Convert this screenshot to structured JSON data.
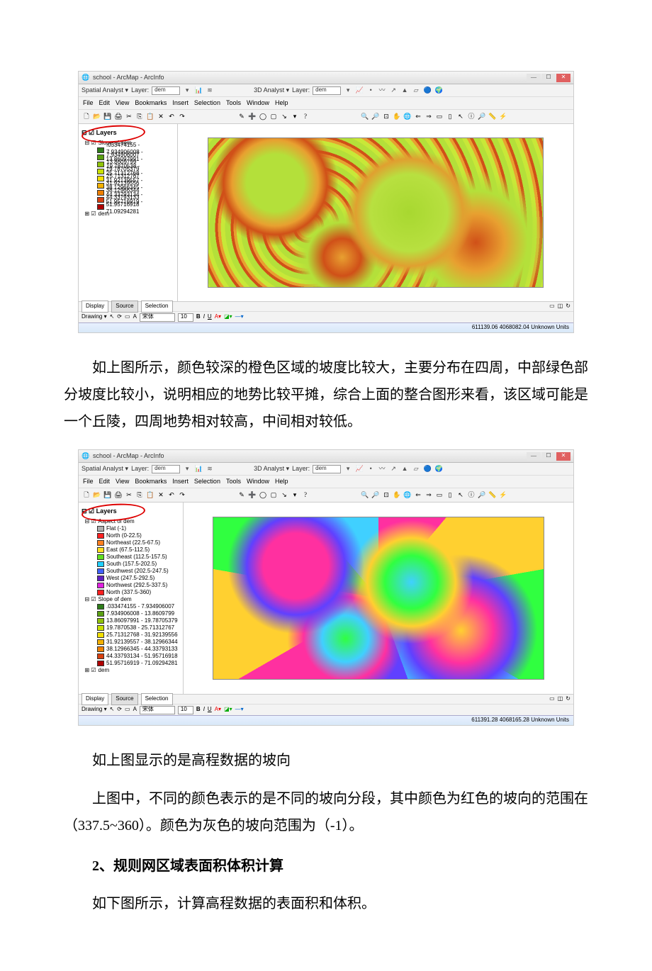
{
  "screenshot1": {
    "window_title": "school - ArcMap - ArcInfo",
    "spatial_toolbar": {
      "label": "Spatial Analyst ▾",
      "layer_label": "Layer:",
      "layer_value": "dem"
    },
    "analyst3d_toolbar": {
      "label": "3D Analyst ▾",
      "layer_label": "Layer:",
      "layer_value": "dem"
    },
    "menu": [
      "File",
      "Edit",
      "View",
      "Bookmarks",
      "Insert",
      "Selection",
      "Tools",
      "Window",
      "Help"
    ],
    "toc": {
      "root": "Layers",
      "group": "Slope of dem",
      "items": [
        {
          "color": "#2e7d1a",
          "label": ".033474155 - 7.934906007"
        },
        {
          "color": "#5aa012",
          "label": "7.934906008 - 13.8609799"
        },
        {
          "color": "#8fc20a",
          "label": "13.86097991 - 19.78705379"
        },
        {
          "color": "#c9e000",
          "label": "19.7870538 - 25.71312767"
        },
        {
          "color": "#f3e000",
          "label": "25.71312768 - 31.92139556"
        },
        {
          "color": "#f3b000",
          "label": "31.92139557 - 38.12966344"
        },
        {
          "color": "#f08000",
          "label": "38.12966345 - 44.33793133"
        },
        {
          "color": "#d84010",
          "label": "44.33793134 - 51.95716918"
        },
        {
          "color": "#b00000",
          "label": "51.95716919 - 71.09294281"
        }
      ],
      "dem_label": "dem"
    },
    "bottom_tabs": [
      "Display",
      "Source",
      "Selection"
    ],
    "drawing": {
      "label": "Drawing ▾",
      "font": "宋体",
      "size": "10"
    },
    "status": "611139.06 4068082.04 Unknown Units"
  },
  "paragraph1": "如上图所示，颜色较深的橙色区域的坡度比较大，主要分布在四周，中部绿色部分坡度比较小，说明相应的地势比较平摊，综合上面的整合图形来看，该区域可能是一个丘陵，四周地势相对较高，中间相对较低。",
  "screenshot2": {
    "window_title": "school - ArcMap - ArcInfo",
    "spatial_toolbar": {
      "label": "Spatial Analyst ▾",
      "layer_label": "Layer:",
      "layer_value": "dem"
    },
    "analyst3d_toolbar": {
      "label": "3D Analyst ▾",
      "layer_label": "Layer:",
      "layer_value": "dem"
    },
    "menu": [
      "File",
      "Edit",
      "View",
      "Bookmarks",
      "Insert",
      "Selection",
      "Tools",
      "Window",
      "Help"
    ],
    "toc": {
      "root": "Layers",
      "group": "Aspect of dem",
      "items": [
        {
          "color": "#b0b0b0",
          "label": "Flat (-1)"
        },
        {
          "color": "#ff2020",
          "label": "North (0-22.5)"
        },
        {
          "color": "#ff8020",
          "label": "Northeast (22.5-67.5)"
        },
        {
          "color": "#ffe020",
          "label": "East (67.5-112.5)"
        },
        {
          "color": "#60e020",
          "label": "Southeast (112.5-157.5)"
        },
        {
          "color": "#20d0ff",
          "label": "South (157.5-202.5)"
        },
        {
          "color": "#4060ff",
          "label": "Southwest (202.5-247.5)"
        },
        {
          "color": "#6020c0",
          "label": "West (247.5-292.5)"
        },
        {
          "color": "#e020e0",
          "label": "Northwest (292.5-337.5)"
        },
        {
          "color": "#ff2020",
          "label": "North (337.5-360)"
        }
      ],
      "group2": "Slope of dem",
      "items2": [
        {
          "color": "#2e7d1a",
          "label": ".033474155 - 7.934906007"
        },
        {
          "color": "#5aa012",
          "label": "7.934906008 - 13.8609799"
        },
        {
          "color": "#8fc20a",
          "label": "13.86097991 - 19.78705379"
        },
        {
          "color": "#c9e000",
          "label": "19.7870538 - 25.71312767"
        },
        {
          "color": "#f3e000",
          "label": "25.71312768 - 31.92139556"
        },
        {
          "color": "#f3b000",
          "label": "31.92139557 - 38.12966344"
        },
        {
          "color": "#f08000",
          "label": "38.12966345 - 44.33793133"
        },
        {
          "color": "#d84010",
          "label": "44.33793134 - 51.95716918"
        },
        {
          "color": "#b00000",
          "label": "51.95716919 - 71.09294281"
        }
      ],
      "dem_label": "dem"
    },
    "bottom_tabs": [
      "Display",
      "Source",
      "Selection"
    ],
    "drawing": {
      "label": "Drawing ▾",
      "font": "宋体",
      "size": "10"
    },
    "status": "611391.28 4068165.28 Unknown Units"
  },
  "paragraph2": "如上图显示的是高程数据的坡向",
  "paragraph3": "上图中，不同的颜色表示的是不同的坡向分段，其中颜色为红色的坡向的范围在（337.5~360）。颜色为灰色的坡向范围为（-1）。",
  "section_heading": "2、规则网区域表面积体积计算",
  "paragraph4": "如下图所示，计算高程数据的表面积和体积。"
}
